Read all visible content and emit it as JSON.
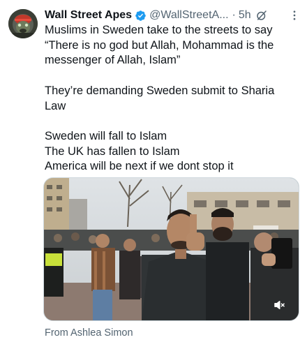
{
  "tweet": {
    "author": {
      "display_name": "Wall Street Apes",
      "handle": "@WallStreetA...",
      "verified": true,
      "verified_color": "#1d9bf0"
    },
    "time": "5h",
    "separator": "·",
    "icons": {
      "avatar": "gorilla-avatar",
      "verified": "verified-badge-icon",
      "grok": "grok-icon",
      "more": "more-options-icon",
      "mute": "volume-muted-icon"
    },
    "paragraphs": [
      [
        "Muslims in Sweden take to the streets to say",
        "“There is no god but Allah, Mohammad is the",
        "messenger of Allah, Islam”"
      ],
      [
        "They’re demanding Sweden submit to Sharia",
        "Law"
      ],
      [
        "Sweden will fall to Islam",
        "The UK has fallen to Islam",
        "America will be next if we dont stop it"
      ]
    ],
    "media": {
      "type": "video",
      "muted": true
    },
    "source_label": "From Ashlea Simon"
  }
}
